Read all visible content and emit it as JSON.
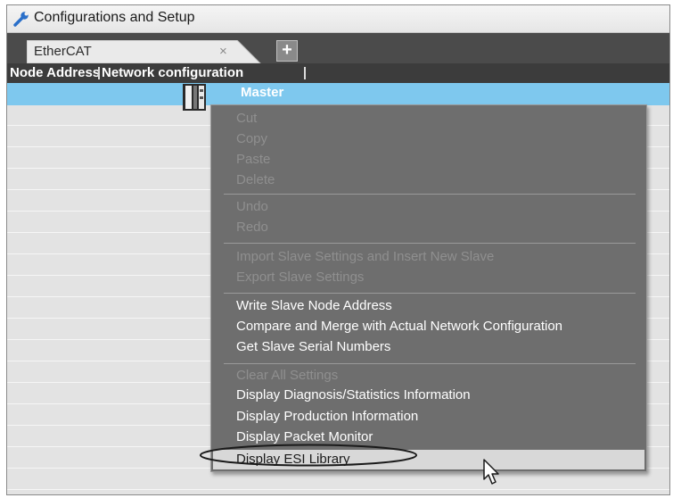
{
  "window": {
    "title": "Configurations and Setup",
    "title_icon": "wrench-icon"
  },
  "tabs": [
    {
      "label": "EtherCAT",
      "close": "×"
    }
  ],
  "add_tab": {
    "label": "+"
  },
  "columns": {
    "node_address": "Node Address",
    "network_config": "Network configuration"
  },
  "master": {
    "label": "Master"
  },
  "context_menu": {
    "cut": "Cut",
    "copy": "Copy",
    "paste": "Paste",
    "delete": "Delete",
    "undo": "Undo",
    "redo": "Redo",
    "import_slave": "Import Slave Settings and Insert New Slave",
    "export_slave": "Export Slave Settings",
    "write_node_address": "Write Slave Node Address",
    "compare_merge": "Compare and Merge with Actual Network Configuration",
    "get_serial": "Get Slave Serial Numbers",
    "clear_all": "Clear All Settings",
    "diag_stats": "Display Diagnosis/Statistics Information",
    "production_info": "Display Production Information",
    "packet_monitor": "Display Packet Monitor",
    "esi_library": "Display ESI Library"
  },
  "colors": {
    "selection": "#7ec8ee",
    "menu_bg": "#6e6e6e",
    "tabbar": "#4b4b4b"
  }
}
